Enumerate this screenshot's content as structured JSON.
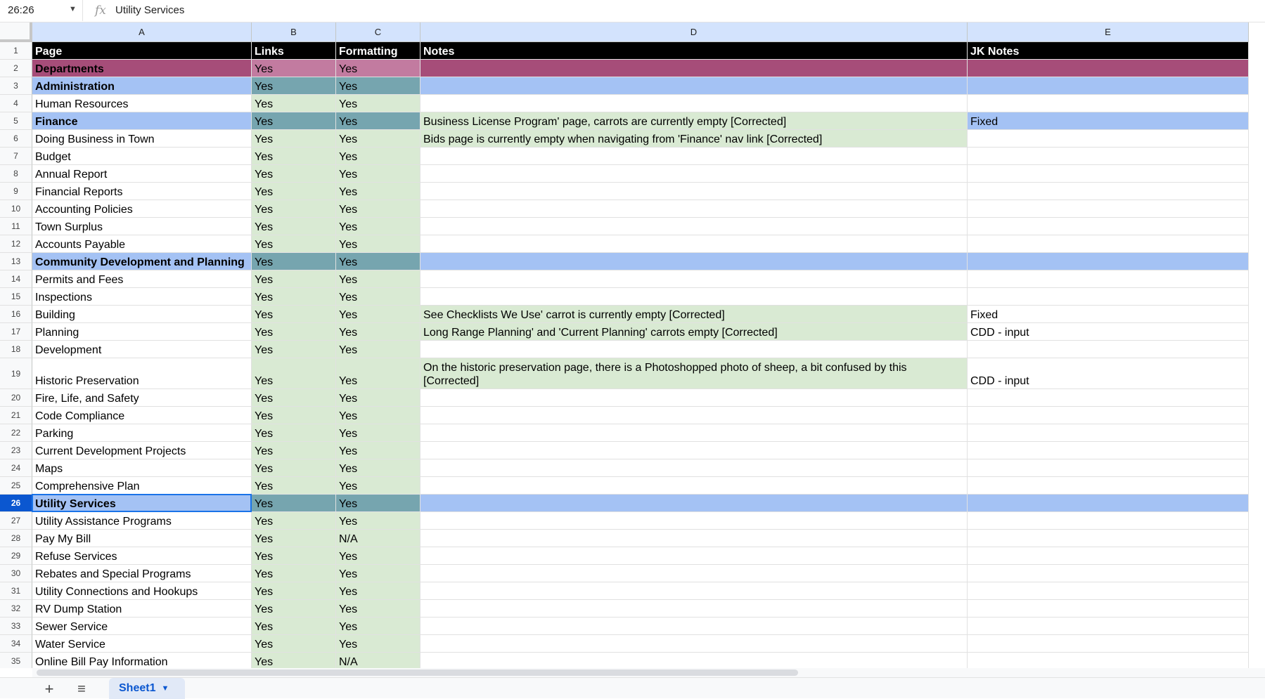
{
  "formula_bar": {
    "name_box": "26:26",
    "fx_label": "fx",
    "formula": "Utility Services"
  },
  "columns": [
    "A",
    "B",
    "C",
    "D",
    "E"
  ],
  "rows": [
    {
      "num": "1",
      "style": "header",
      "a": "Page",
      "b": "Links",
      "c": "Formatting",
      "d": "Notes",
      "e": "JK Notes"
    },
    {
      "num": "2",
      "style": "dept",
      "a": "Departments",
      "b": "Yes",
      "c": "Yes",
      "d": "",
      "e": ""
    },
    {
      "num": "3",
      "style": "section",
      "a": "Administration",
      "b": "Yes",
      "c": "Yes",
      "d": "",
      "e": ""
    },
    {
      "num": "4",
      "style": "plain",
      "a": "Human Resources",
      "b": "Yes",
      "c": "Yes",
      "d": "",
      "e": ""
    },
    {
      "num": "5",
      "style": "section-note",
      "a": "Finance",
      "b": "Yes",
      "c": "Yes",
      "d": "Business License Program' page, carrots are currently empty [Corrected]",
      "e": "Fixed"
    },
    {
      "num": "6",
      "style": "plain-note",
      "a": "Doing Business in Town",
      "b": "Yes",
      "c": "Yes",
      "d": "Bids page is currently empty when navigating from 'Finance' nav link [Corrected]",
      "e": ""
    },
    {
      "num": "7",
      "style": "plain",
      "a": "Budget",
      "b": "Yes",
      "c": "Yes",
      "d": "",
      "e": ""
    },
    {
      "num": "8",
      "style": "plain",
      "a": "Annual Report",
      "b": "Yes",
      "c": "Yes",
      "d": "",
      "e": ""
    },
    {
      "num": "9",
      "style": "plain",
      "a": "Financial Reports",
      "b": "Yes",
      "c": "Yes",
      "d": "",
      "e": ""
    },
    {
      "num": "10",
      "style": "plain",
      "a": "Accounting Policies",
      "b": "Yes",
      "c": "Yes",
      "d": "",
      "e": ""
    },
    {
      "num": "11",
      "style": "plain",
      "a": "Town Surplus",
      "b": "Yes",
      "c": "Yes",
      "d": "",
      "e": ""
    },
    {
      "num": "12",
      "style": "plain",
      "a": "Accounts Payable",
      "b": "Yes",
      "c": "Yes",
      "d": "",
      "e": ""
    },
    {
      "num": "13",
      "style": "section",
      "a": "Community Development and Planning",
      "b": "Yes",
      "c": "Yes",
      "d": "",
      "e": ""
    },
    {
      "num": "14",
      "style": "plain",
      "a": "Permits and Fees",
      "b": "Yes",
      "c": "Yes",
      "d": "",
      "e": ""
    },
    {
      "num": "15",
      "style": "plain",
      "a": "Inspections",
      "b": "Yes",
      "c": "Yes",
      "d": "",
      "e": ""
    },
    {
      "num": "16",
      "style": "plain-note",
      "a": "Building",
      "b": "Yes",
      "c": "Yes",
      "d": "See Checklists We Use' carrot is currently empty [Corrected]",
      "e": "Fixed"
    },
    {
      "num": "17",
      "style": "plain-note",
      "a": "Planning",
      "b": "Yes",
      "c": "Yes",
      "d": "Long Range Planning' and 'Current Planning' carrots empty [Corrected]",
      "e": "CDD - input"
    },
    {
      "num": "18",
      "style": "plain",
      "a": "Development",
      "b": "Yes",
      "c": "Yes",
      "d": "",
      "e": ""
    },
    {
      "num": "19",
      "style": "plain-note-tall",
      "a": "Historic Preservation",
      "b": "Yes",
      "c": "Yes",
      "d": "On the historic preservation page, there is a Photoshopped photo of sheep, a bit confused by this [Corrected]",
      "e": "CDD - input"
    },
    {
      "num": "20",
      "style": "plain",
      "a": "Fire, Life, and Safety",
      "b": "Yes",
      "c": "Yes",
      "d": "",
      "e": ""
    },
    {
      "num": "21",
      "style": "plain",
      "a": "Code Compliance",
      "b": "Yes",
      "c": "Yes",
      "d": "",
      "e": ""
    },
    {
      "num": "22",
      "style": "plain",
      "a": "Parking",
      "b": "Yes",
      "c": "Yes",
      "d": "",
      "e": ""
    },
    {
      "num": "23",
      "style": "plain",
      "a": "Current Development Projects",
      "b": "Yes",
      "c": "Yes",
      "d": "",
      "e": ""
    },
    {
      "num": "24",
      "style": "plain",
      "a": "Maps",
      "b": "Yes",
      "c": "Yes",
      "d": "",
      "e": ""
    },
    {
      "num": "25",
      "style": "plain",
      "a": "Comprehensive Plan",
      "b": "Yes",
      "c": "Yes",
      "d": "",
      "e": ""
    },
    {
      "num": "26",
      "style": "section",
      "a": "Utility Services",
      "b": "Yes",
      "c": "Yes",
      "d": "",
      "e": "",
      "active": true
    },
    {
      "num": "27",
      "style": "plain",
      "a": "Utility Assistance Programs",
      "b": "Yes",
      "c": "Yes",
      "d": "",
      "e": ""
    },
    {
      "num": "28",
      "style": "plain",
      "a": "Pay My Bill",
      "b": "Yes",
      "c": "N/A",
      "d": "",
      "e": ""
    },
    {
      "num": "29",
      "style": "plain",
      "a": "Refuse Services",
      "b": "Yes",
      "c": "Yes",
      "d": "",
      "e": ""
    },
    {
      "num": "30",
      "style": "plain",
      "a": "Rebates and Special Programs",
      "b": "Yes",
      "c": "Yes",
      "d": "",
      "e": ""
    },
    {
      "num": "31",
      "style": "plain",
      "a": "Utility Connections and Hookups",
      "b": "Yes",
      "c": "Yes",
      "d": "",
      "e": ""
    },
    {
      "num": "32",
      "style": "plain",
      "a": "RV Dump Station",
      "b": "Yes",
      "c": "Yes",
      "d": "",
      "e": ""
    },
    {
      "num": "33",
      "style": "plain",
      "a": "Sewer Service",
      "b": "Yes",
      "c": "Yes",
      "d": "",
      "e": ""
    },
    {
      "num": "34",
      "style": "plain",
      "a": "Water Service",
      "b": "Yes",
      "c": "Yes",
      "d": "",
      "e": ""
    },
    {
      "num": "35",
      "style": "plain",
      "a": "Online Bill Pay Information",
      "b": "Yes",
      "c": "N/A",
      "d": "",
      "e": ""
    }
  ],
  "sheet_bar": {
    "add_icon": "plus-icon",
    "menu_icon": "hamburger-icon",
    "tab_label": "Sheet1"
  },
  "colors": {
    "header": "#000000",
    "dept": "#a64d79",
    "section": "#a4c2f4",
    "section_status": "#76a5af",
    "green": "#d9ead3",
    "selection": "#1a73e8"
  }
}
